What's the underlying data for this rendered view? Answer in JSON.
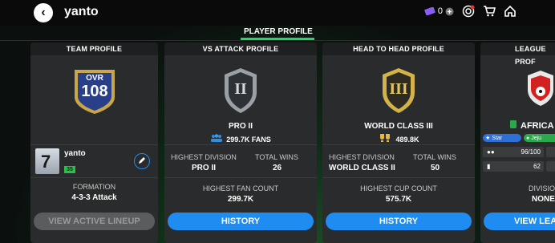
{
  "header": {
    "username": "yanto",
    "coins": "0"
  },
  "tab": {
    "label": "PLAYER PROFILE"
  },
  "team_profile": {
    "title": "TEAM PROFILE",
    "ovr_label": "OVR",
    "ovr_value": "108",
    "player_name": "yanto",
    "player_number": "7",
    "level": "35",
    "formation_label": "FORMATION",
    "formation_value": "4-3-3 Attack",
    "button": "VIEW ACTIVE LINEUP"
  },
  "vs_attack": {
    "title": "VS ATTACK PROFILE",
    "badge_numeral": "II",
    "rank": "PRO II",
    "fans": "299.7K FANS",
    "highest_division_label": "HIGHEST DIVISION",
    "highest_division_value": "PRO II",
    "total_wins_label": "TOTAL WINS",
    "total_wins_value": "26",
    "highest_fan_label": "HIGHEST FAN COUNT",
    "highest_fan_value": "299.7K",
    "button": "HISTORY"
  },
  "head_to_head": {
    "title": "HEAD TO HEAD PROFILE",
    "badge_numeral": "III",
    "rank": "WORLD CLASS III",
    "points": "489.8K",
    "highest_division_label": "HIGHEST DIVISION",
    "highest_division_value": "WORLD CLASS II",
    "total_wins_label": "TOTAL WINS",
    "total_wins_value": "50",
    "highest_cup_label": "HIGHEST CUP COUNT",
    "highest_cup_value": "575.7K",
    "button": "HISTORY"
  },
  "league": {
    "title": "LEAGUE PROF",
    "name": "AFRICA",
    "tag_star": "Star",
    "tag_jeju": "Jeju",
    "members": "96/100",
    "level": "62",
    "division_label": "DIVISIO",
    "division_value": "NONE",
    "button": "VIEW LEA"
  }
}
